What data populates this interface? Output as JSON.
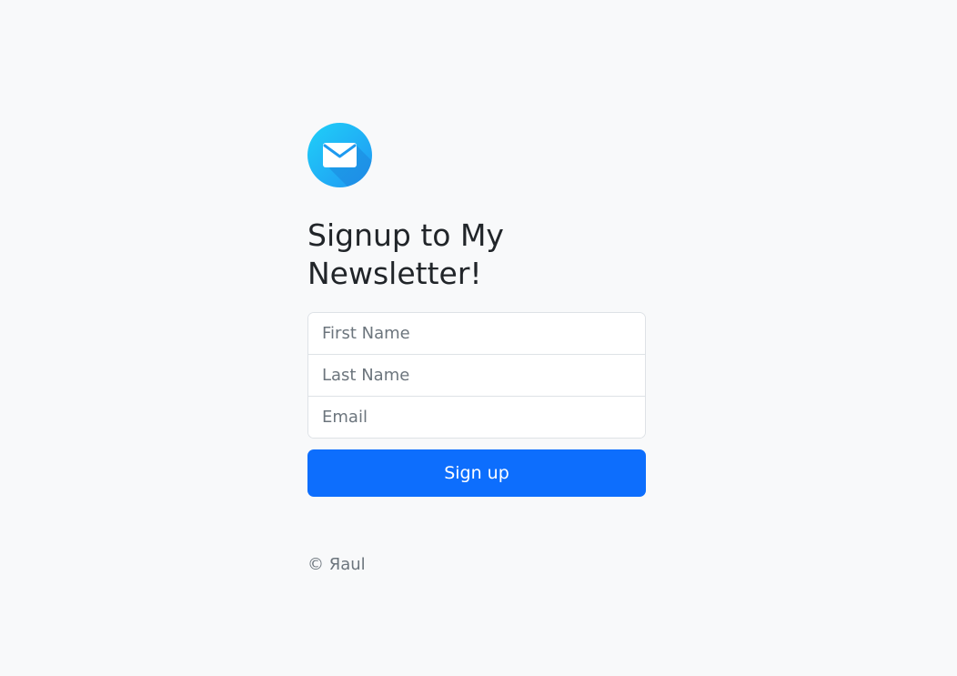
{
  "logo": {
    "icon": "envelope-icon",
    "colors": [
      "#14c6f5",
      "#2196f3"
    ]
  },
  "heading": "Signup to My Newsletter!",
  "form": {
    "first_name_placeholder": "First Name",
    "last_name_placeholder": "Last Name",
    "email_placeholder": "Email",
    "submit_label": "Sign up"
  },
  "footer": {
    "copyright": "© Яaul"
  },
  "colors": {
    "background": "#f8f9fa",
    "primary": "#0d6efd",
    "border": "#dee2e6",
    "muted": "#6c757d"
  }
}
